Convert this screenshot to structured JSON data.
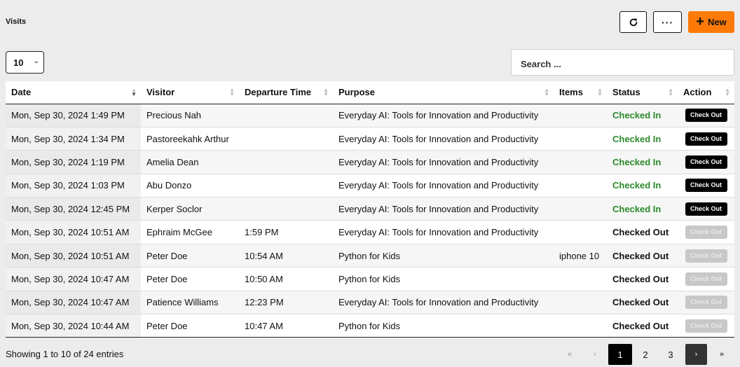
{
  "page": {
    "title": "Visits"
  },
  "toolbar": {
    "refresh_icon": "refresh-icon",
    "more_label": "···",
    "new_label": "New"
  },
  "length": {
    "value": "10"
  },
  "search": {
    "placeholder": "Search ..."
  },
  "table": {
    "columns": [
      "Date",
      "Visitor",
      "Departure Time",
      "Purpose",
      "Items",
      "Status",
      "Action"
    ],
    "rows": [
      {
        "date": "Mon, Sep 30, 2024 1:49 PM",
        "visitor": "Precious Nah",
        "departure": "",
        "purpose": "Everyday AI: Tools for Innovation and Productivity",
        "items": "",
        "status": "Checked In",
        "action": "Check Out"
      },
      {
        "date": "Mon, Sep 30, 2024 1:34 PM",
        "visitor": "Pastoreekahk Arthur",
        "departure": "",
        "purpose": "Everyday AI: Tools for Innovation and Productivity",
        "items": "",
        "status": "Checked In",
        "action": "Check Out"
      },
      {
        "date": "Mon, Sep 30, 2024 1:19 PM",
        "visitor": "Amelia Dean",
        "departure": "",
        "purpose": "Everyday AI: Tools for Innovation and Productivity",
        "items": "",
        "status": "Checked In",
        "action": "Check Out"
      },
      {
        "date": "Mon, Sep 30, 2024 1:03 PM",
        "visitor": "Abu Donzo",
        "departure": "",
        "purpose": "Everyday AI: Tools for Innovation and Productivity",
        "items": "",
        "status": "Checked In",
        "action": "Check Out"
      },
      {
        "date": "Mon, Sep 30, 2024 12:45 PM",
        "visitor": "Kerper Soclor",
        "departure": "",
        "purpose": "Everyday AI: Tools for Innovation and Productivity",
        "items": "",
        "status": "Checked In",
        "action": "Check Out"
      },
      {
        "date": "Mon, Sep 30, 2024 10:51 AM",
        "visitor": "Ephraim McGee",
        "departure": "1:59 PM",
        "purpose": "Everyday AI: Tools for Innovation and Productivity",
        "items": "",
        "status": "Checked Out",
        "action": "Check Out"
      },
      {
        "date": "Mon, Sep 30, 2024 10:51 AM",
        "visitor": "Peter Doe",
        "departure": "10:54 AM",
        "purpose": "Python for Kids",
        "items": "iphone 10",
        "status": "Checked Out",
        "action": "Check Out"
      },
      {
        "date": "Mon, Sep 30, 2024 10:47 AM",
        "visitor": "Peter Doe",
        "departure": "10:50 AM",
        "purpose": "Python for Kids",
        "items": "",
        "status": "Checked Out",
        "action": "Check Out"
      },
      {
        "date": "Mon, Sep 30, 2024 10:47 AM",
        "visitor": "Patience Williams",
        "departure": "12:23 PM",
        "purpose": "Everyday AI: Tools for Innovation and Productivity",
        "items": "",
        "status": "Checked Out",
        "action": "Check Out"
      },
      {
        "date": "Mon, Sep 30, 2024 10:44 AM",
        "visitor": "Peter Doe",
        "departure": "10:47 AM",
        "purpose": "Python for Kids",
        "items": "",
        "status": "Checked Out",
        "action": "Check Out"
      }
    ]
  },
  "footer": {
    "info": "Showing 1 to 10 of 24 entries",
    "pager": {
      "first": "«",
      "prev": "‹",
      "pages": [
        "1",
        "2",
        "3"
      ],
      "next": "›",
      "last": "»"
    }
  },
  "colors": {
    "accent": "#fd7a08",
    "checked_in": "#2b8a2b",
    "checked_out": "#111111"
  }
}
